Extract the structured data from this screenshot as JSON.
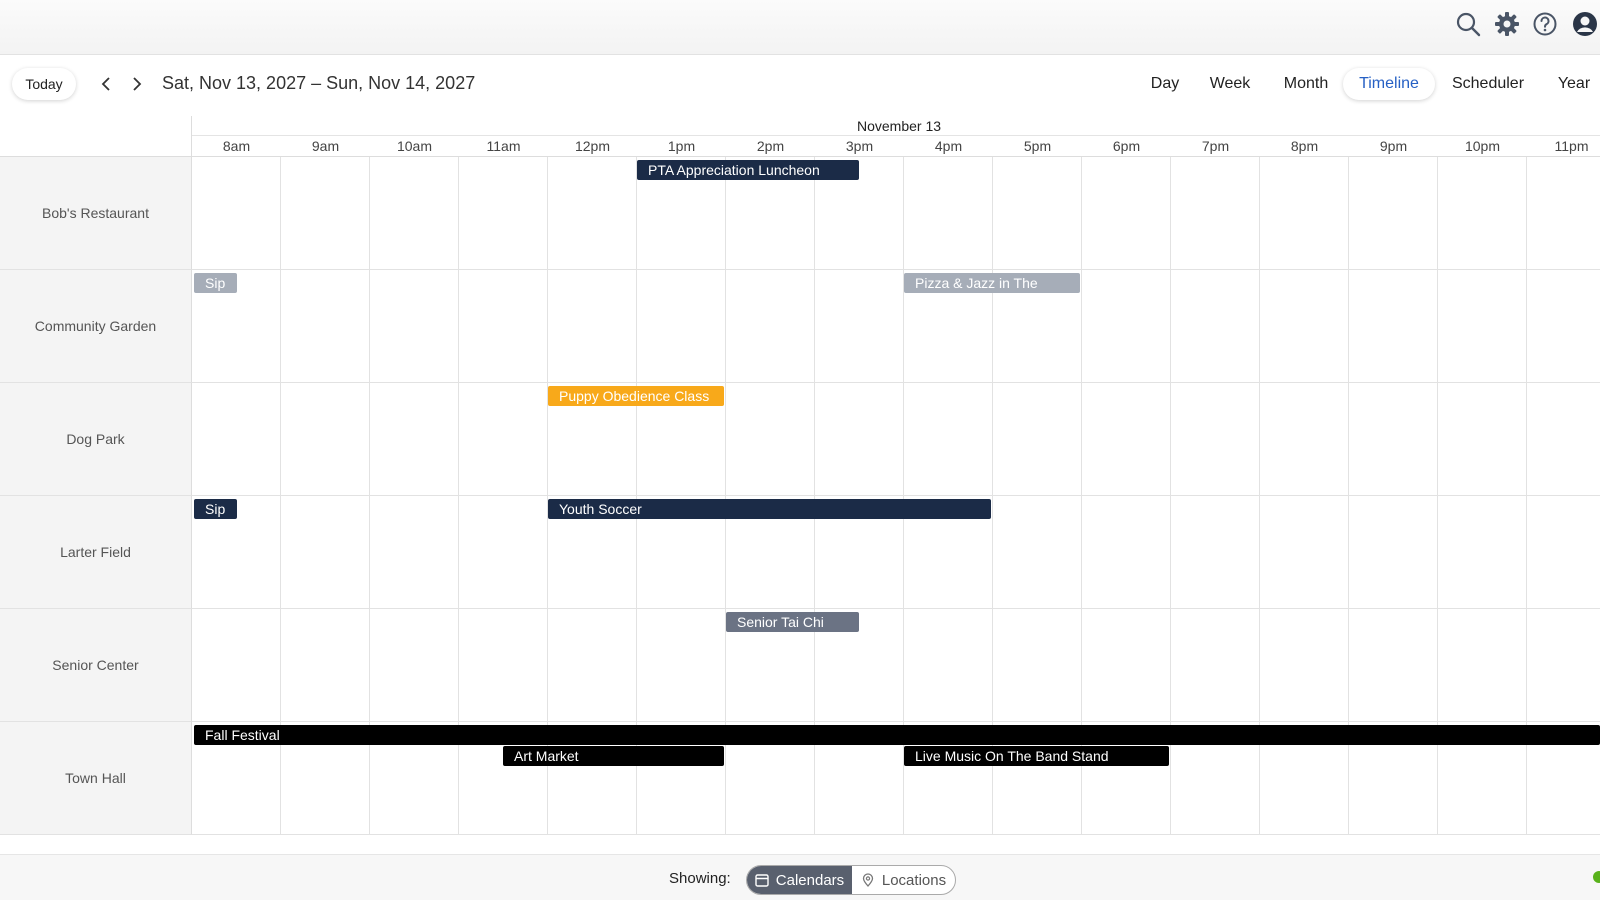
{
  "header": {
    "icons": [
      "search-icon",
      "gear-icon",
      "help-icon",
      "user-icon"
    ]
  },
  "toolbar": {
    "today_label": "Today",
    "prev_icon": "chevron-left-icon",
    "next_icon": "chevron-right-icon",
    "date_range": "Sat, Nov 13, 2027 – Sun, Nov 14, 2027",
    "views": {
      "day": "Day",
      "week": "Week",
      "month": "Month",
      "timeline": "Timeline",
      "scheduler": "Scheduler",
      "year": "Year"
    },
    "active_view": "Timeline"
  },
  "timeline": {
    "date_label": "November 13",
    "hours": [
      "8am",
      "9am",
      "10am",
      "11am",
      "12pm",
      "1pm",
      "2pm",
      "3pm",
      "4pm",
      "5pm",
      "6pm",
      "7pm",
      "8pm",
      "9pm",
      "10pm",
      "11pm"
    ],
    "resources": [
      "Bob's Restaurant",
      "Community Garden",
      "Dog Park",
      "Larter Field",
      "Senior Center",
      "Town Hall"
    ],
    "events": {
      "pta": "PTA Appreciation Luncheon",
      "sip_garden": "Sip",
      "pizza_jazz": "Pizza & Jazz in The",
      "puppy": "Puppy Obedience Class",
      "sip_field": "Sip",
      "youth_soccer": "Youth Soccer",
      "tai_chi": "Senior Tai Chi",
      "fall_festival": "Fall Festival",
      "art_market": "Art Market",
      "live_music": "Live Music On The Band Stand"
    }
  },
  "footer": {
    "showing_label": "Showing:",
    "calendars_label": "Calendars",
    "locations_label": "Locations",
    "calendar_icon": "calendar-icon",
    "location_icon": "location-pin-icon"
  },
  "colors": {
    "accent": "#2660c4",
    "navy": "#1b2b47",
    "gray_event": "#a6adb8",
    "orange_event": "#f8a91a",
    "slate_event": "#6b7384",
    "black_event": "#000000",
    "status_green": "#59b21b"
  }
}
